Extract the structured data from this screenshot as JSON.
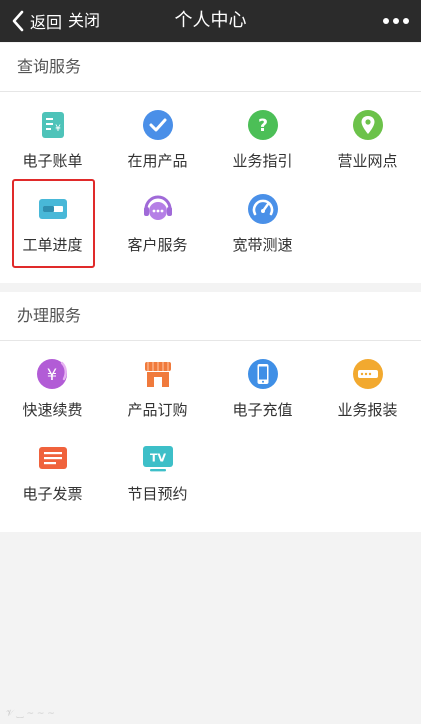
{
  "header": {
    "back_label": "返回",
    "close_label": "关闭",
    "title": "个人中心"
  },
  "sections": [
    {
      "title": "查询服务",
      "items": [
        {
          "label": "电子账单",
          "icon": "bill-icon",
          "color": "#4ec3b9"
        },
        {
          "label": "在用产品",
          "icon": "check-circle-icon",
          "color": "#4a8fe8"
        },
        {
          "label": "业务指引",
          "icon": "help-circle-icon",
          "color": "#4cbf57"
        },
        {
          "label": "营业网点",
          "icon": "location-pin-icon",
          "color": "#6cc24a"
        },
        {
          "label": "工单进度",
          "icon": "progress-card-icon",
          "color": "#48b8d8"
        },
        {
          "label": "客户服务",
          "icon": "headset-chat-icon",
          "color": "#a06ad8"
        },
        {
          "label": "宽带测速",
          "icon": "speedometer-icon",
          "color": "#4a90e8"
        }
      ]
    },
    {
      "title": "办理服务",
      "items": [
        {
          "label": "快速续费",
          "icon": "yen-coin-icon",
          "color": "#b25cd6"
        },
        {
          "label": "产品订购",
          "icon": "storefront-icon",
          "color": "#f07a3c"
        },
        {
          "label": "电子充值",
          "icon": "mobile-phone-icon",
          "color": "#3f8fe6"
        },
        {
          "label": "业务报装",
          "icon": "router-device-icon",
          "color": "#f2a92f"
        },
        {
          "label": "电子发票",
          "icon": "invoice-icon",
          "color": "#f0623c"
        },
        {
          "label": "节目预约",
          "icon": "tv-icon",
          "color": "#3dbfc8",
          "glyph": "TV"
        }
      ]
    }
  ],
  "highlighted_item": "工单进度",
  "highlight_color": "#e02a2a"
}
